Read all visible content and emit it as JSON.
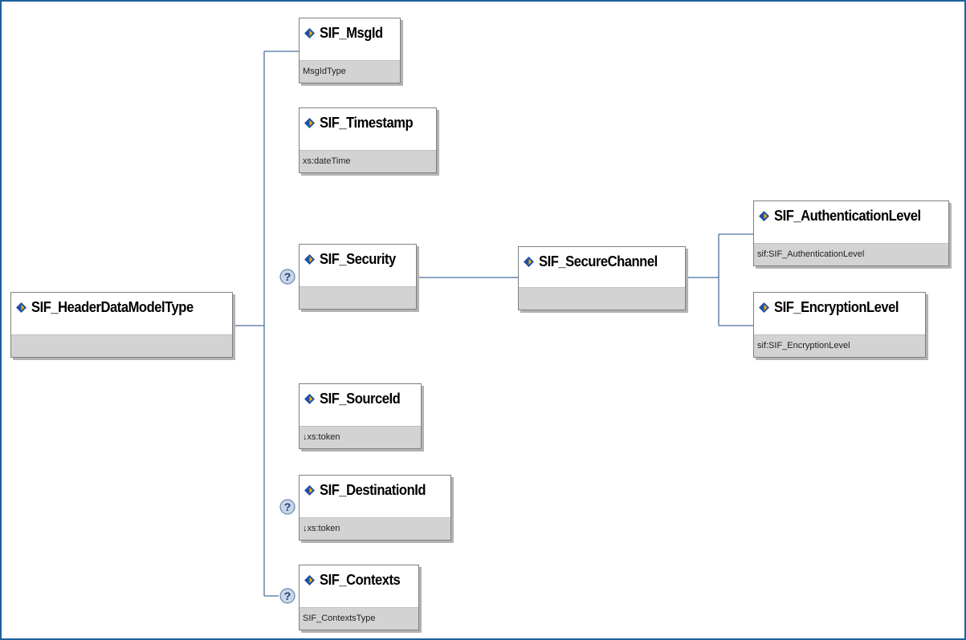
{
  "diagram": {
    "root": {
      "name": "SIF_HeaderDataModelType",
      "type": ""
    },
    "children": [
      {
        "name": "SIF_MsgId",
        "type": "MsgIdType",
        "optional": false
      },
      {
        "name": "SIF_Timestamp",
        "type": "xs:dateTime",
        "optional": false
      },
      {
        "name": "SIF_Security",
        "type": "",
        "optional": true
      },
      {
        "name": "SIF_SourceId",
        "type": "↓xs:token",
        "optional": false
      },
      {
        "name": "SIF_DestinationId",
        "type": "↓xs:token",
        "optional": true
      },
      {
        "name": "SIF_Contexts",
        "type": "SIF_ContextsType",
        "optional": true
      }
    ],
    "security_child": {
      "name": "SIF_SecureChannel",
      "type": ""
    },
    "secure_channel_children": [
      {
        "name": "SIF_AuthenticationLevel",
        "type": "sif:SIF_AuthenticationLevel"
      },
      {
        "name": "SIF_EncryptionLevel",
        "type": "sif:SIF_EncryptionLevel"
      }
    ],
    "optional_marker": "?"
  },
  "colors": {
    "border": "#1f5fa0",
    "connector": "#4a6f9c",
    "type_band": "#d3d3d3",
    "icon_blue": "#1e4fa8",
    "icon_gold": "#f0b400"
  }
}
